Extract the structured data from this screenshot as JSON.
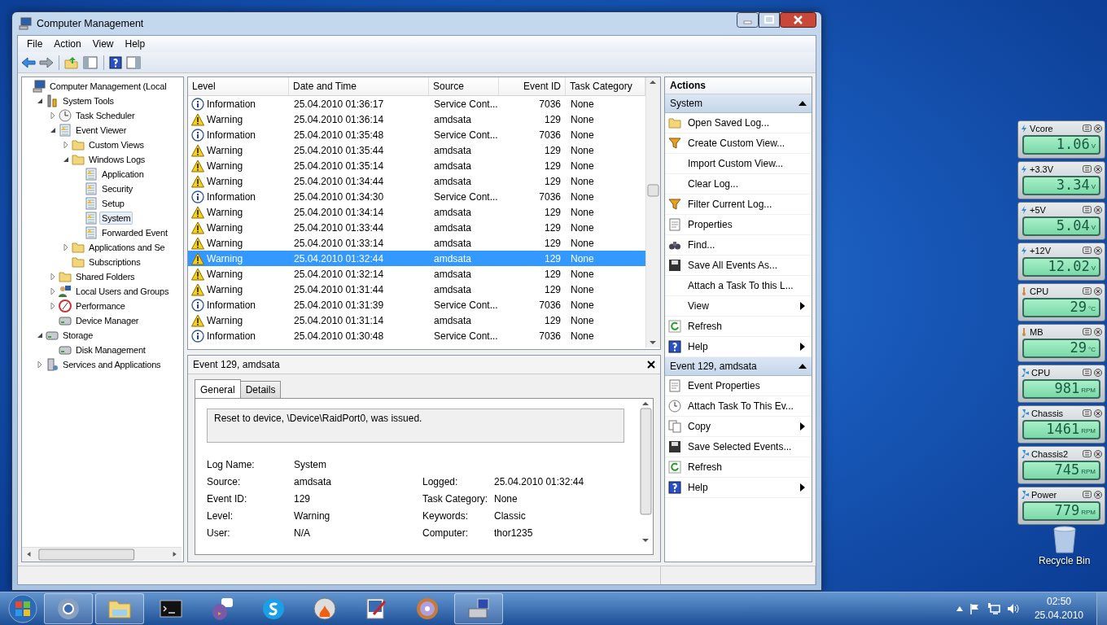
{
  "window": {
    "title": "Computer Management"
  },
  "menu": [
    "File",
    "Action",
    "View",
    "Help"
  ],
  "toolbar": [
    {
      "kind": "back"
    },
    {
      "kind": "forward"
    },
    {
      "kind": "up"
    },
    {
      "kind": "tree"
    },
    {
      "kind": "help"
    },
    {
      "kind": "pane"
    }
  ],
  "tree": [
    {
      "label": "Computer Management (Local",
      "kind": "computer",
      "selected": false,
      "children": [
        {
          "label": "System Tools",
          "kind": "tools",
          "expanded": true,
          "selected": false,
          "children": [
            {
              "label": "Task Scheduler",
              "kind": "clock",
              "expanded": false,
              "selected": false
            },
            {
              "label": "Event Viewer",
              "kind": "log",
              "expanded": true,
              "selected": false,
              "children": [
                {
                  "label": "Custom Views",
                  "kind": "folder",
                  "expanded": false,
                  "selected": false
                },
                {
                  "label": "Windows Logs",
                  "kind": "folder",
                  "expanded": true,
                  "selected": false,
                  "children": [
                    {
                      "label": "Application",
                      "kind": "log",
                      "selected": false
                    },
                    {
                      "label": "Security",
                      "kind": "log",
                      "selected": false
                    },
                    {
                      "label": "Setup",
                      "kind": "log",
                      "selected": false
                    },
                    {
                      "label": "System",
                      "kind": "log",
                      "selected": true
                    },
                    {
                      "label": "Forwarded Event",
                      "kind": "log",
                      "selected": false
                    }
                  ]
                },
                {
                  "label": "Applications and Se",
                  "kind": "folder",
                  "expanded": false,
                  "selected": false
                },
                {
                  "label": "Subscriptions",
                  "kind": "folder",
                  "selected": false
                }
              ]
            },
            {
              "label": "Shared Folders",
              "kind": "folder",
              "expanded": false,
              "selected": false
            },
            {
              "label": "Local Users and Groups",
              "kind": "people",
              "expanded": false,
              "selected": false
            },
            {
              "label": "Performance",
              "kind": "gauge",
              "expanded": false,
              "selected": false
            },
            {
              "label": "Device Manager",
              "kind": "drive",
              "selected": false
            }
          ]
        },
        {
          "label": "Storage",
          "kind": "drive",
          "expanded": true,
          "selected": false,
          "children": [
            {
              "label": "Disk Management",
              "kind": "drive",
              "selected": false
            }
          ]
        },
        {
          "label": "Services and Applications",
          "kind": "server",
          "expanded": false,
          "selected": false
        }
      ]
    }
  ],
  "events": {
    "columns": [
      "Level",
      "Date and Time",
      "Source",
      "Event ID",
      "Task Category"
    ],
    "rows": [
      {
        "kind": "information",
        "cells": [
          "Information",
          "25.04.2010 01:36:17",
          "Service Cont...",
          "7036",
          "None"
        ],
        "selected": false
      },
      {
        "kind": "warning",
        "cells": [
          "Warning",
          "25.04.2010 01:36:14",
          "amdsata",
          "129",
          "None"
        ],
        "selected": false
      },
      {
        "kind": "information",
        "cells": [
          "Information",
          "25.04.2010 01:35:48",
          "Service Cont...",
          "7036",
          "None"
        ],
        "selected": false
      },
      {
        "kind": "warning",
        "cells": [
          "Warning",
          "25.04.2010 01:35:44",
          "amdsata",
          "129",
          "None"
        ],
        "selected": false
      },
      {
        "kind": "warning",
        "cells": [
          "Warning",
          "25.04.2010 01:35:14",
          "amdsata",
          "129",
          "None"
        ],
        "selected": false
      },
      {
        "kind": "warning",
        "cells": [
          "Warning",
          "25.04.2010 01:34:44",
          "amdsata",
          "129",
          "None"
        ],
        "selected": false
      },
      {
        "kind": "information",
        "cells": [
          "Information",
          "25.04.2010 01:34:30",
          "Service Cont...",
          "7036",
          "None"
        ],
        "selected": false
      },
      {
        "kind": "warning",
        "cells": [
          "Warning",
          "25.04.2010 01:34:14",
          "amdsata",
          "129",
          "None"
        ],
        "selected": false
      },
      {
        "kind": "warning",
        "cells": [
          "Warning",
          "25.04.2010 01:33:44",
          "amdsata",
          "129",
          "None"
        ],
        "selected": false
      },
      {
        "kind": "warning",
        "cells": [
          "Warning",
          "25.04.2010 01:33:14",
          "amdsata",
          "129",
          "None"
        ],
        "selected": false
      },
      {
        "kind": "warning",
        "cells": [
          "Warning",
          "25.04.2010 01:32:44",
          "amdsata",
          "129",
          "None"
        ],
        "selected": true
      },
      {
        "kind": "warning",
        "cells": [
          "Warning",
          "25.04.2010 01:32:14",
          "amdsata",
          "129",
          "None"
        ],
        "selected": false
      },
      {
        "kind": "warning",
        "cells": [
          "Warning",
          "25.04.2010 01:31:44",
          "amdsata",
          "129",
          "None"
        ],
        "selected": false
      },
      {
        "kind": "information",
        "cells": [
          "Information",
          "25.04.2010 01:31:39",
          "Service Cont...",
          "7036",
          "None"
        ],
        "selected": false
      },
      {
        "kind": "warning",
        "cells": [
          "Warning",
          "25.04.2010 01:31:14",
          "amdsata",
          "129",
          "None"
        ],
        "selected": false
      },
      {
        "kind": "information",
        "cells": [
          "Information",
          "25.04.2010 01:30:48",
          "Service Cont...",
          "7036",
          "None"
        ],
        "selected": false
      }
    ]
  },
  "details": {
    "title": "Event 129, amdsata",
    "tabs": [
      {
        "label": "General",
        "selected": true
      },
      {
        "label": "Details",
        "selected": false
      }
    ],
    "message": "Reset to device, \\Device\\RaidPort0, was issued.",
    "fields": [
      [
        {
          "label": "Log Name:",
          "value": "System"
        }
      ],
      [
        {
          "label": "Source:",
          "value": "amdsata"
        },
        {
          "label": "Logged:",
          "value": "25.04.2010 01:32:44"
        }
      ],
      [
        {
          "label": "Event ID:",
          "value": "129"
        },
        {
          "label": "Task Category:",
          "value": "None"
        }
      ],
      [
        {
          "label": "Level:",
          "value": "Warning"
        },
        {
          "label": "Keywords:",
          "value": "Classic"
        }
      ],
      [
        {
          "label": "User:",
          "value": "N/A"
        },
        {
          "label": "Computer:",
          "value": "thor1235"
        }
      ]
    ]
  },
  "actions": {
    "title": "Actions",
    "sections": [
      {
        "title": "System",
        "expanded": true,
        "items": [
          {
            "label": "Open Saved Log...",
            "kind": "open",
            "submenu": false
          },
          {
            "label": "Create Custom View...",
            "kind": "filter",
            "submenu": false
          },
          {
            "label": "Import Custom View...",
            "kind": "none",
            "submenu": false
          },
          {
            "label": "Clear Log...",
            "kind": "none",
            "submenu": false
          },
          {
            "label": "Filter Current Log...",
            "kind": "filter",
            "submenu": false
          },
          {
            "label": "Properties",
            "kind": "page",
            "submenu": false
          },
          {
            "label": "Find...",
            "kind": "find",
            "submenu": false
          },
          {
            "label": "Save All Events As...",
            "kind": "save",
            "submenu": false
          },
          {
            "label": "Attach a Task To this L...",
            "kind": "none",
            "submenu": false
          },
          {
            "label": "View",
            "kind": "none",
            "submenu": true
          },
          {
            "label": "Refresh",
            "kind": "refresh",
            "submenu": false
          },
          {
            "label": "Help",
            "kind": "help",
            "submenu": true
          }
        ]
      },
      {
        "title": "Event 129, amdsata",
        "expanded": true,
        "items": [
          {
            "label": "Event Properties",
            "kind": "page",
            "submenu": false
          },
          {
            "label": "Attach Task To This Ev...",
            "kind": "task",
            "submenu": false
          },
          {
            "label": "Copy",
            "kind": "copy",
            "submenu": true
          },
          {
            "label": "Save Selected Events...",
            "kind": "save",
            "submenu": false
          },
          {
            "label": "Refresh",
            "kind": "refresh",
            "submenu": false
          },
          {
            "label": "Help",
            "kind": "help",
            "submenu": true
          }
        ]
      }
    ]
  },
  "gadgets": [
    {
      "kind": "voltage",
      "label": "Vcore",
      "value": "1.06",
      "unit": "V"
    },
    {
      "kind": "voltage",
      "label": "+3.3V",
      "value": "3.34",
      "unit": "V"
    },
    {
      "kind": "voltage",
      "label": "+5V",
      "value": "5.04",
      "unit": "V"
    },
    {
      "kind": "voltage",
      "label": "+12V",
      "value": "12.02",
      "unit": "V"
    },
    {
      "kind": "temperature",
      "label": "CPU",
      "value": "29",
      "unit": "°C"
    },
    {
      "kind": "temperature",
      "label": "MB",
      "value": "29",
      "unit": "°C"
    },
    {
      "kind": "fan",
      "label": "CPU",
      "value": "981",
      "unit": "RPM"
    },
    {
      "kind": "fan",
      "label": "Chassis",
      "value": "1461",
      "unit": "RPM"
    },
    {
      "kind": "fan",
      "label": "Chassis2",
      "value": "745",
      "unit": "RPM"
    },
    {
      "kind": "fan",
      "label": "Power",
      "value": "779",
      "unit": "RPM"
    }
  ],
  "desktop_icons": [
    {
      "label": "Recycle Bin"
    }
  ],
  "taskbar": {
    "apps": [
      {
        "kind": "browser",
        "running": true
      },
      {
        "kind": "folder",
        "running": true
      },
      {
        "kind": "terminal",
        "running": false
      },
      {
        "kind": "chat",
        "running": false
      },
      {
        "kind": "phone",
        "running": false
      },
      {
        "kind": "burner",
        "running": false
      },
      {
        "kind": "paint",
        "running": false
      },
      {
        "kind": "disc",
        "running": false
      },
      {
        "kind": "toolbox",
        "running": true
      }
    ],
    "time": "02:50",
    "date": "25.04.2010"
  }
}
